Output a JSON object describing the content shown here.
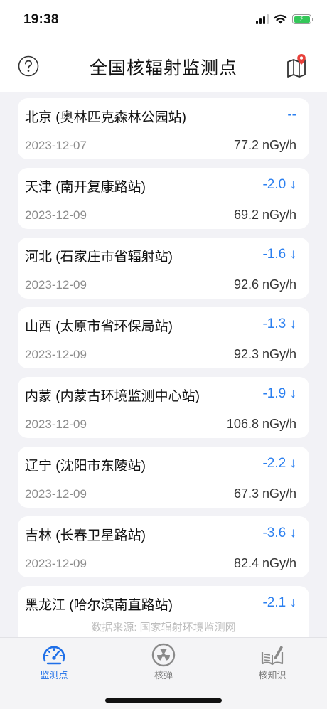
{
  "status_bar": {
    "time": "19:38"
  },
  "nav": {
    "title": "全国核辐射监测点",
    "help_icon": "question-circle-icon",
    "map_icon": "map-pin-icon"
  },
  "stations": [
    {
      "name": "北京 (奥林匹克森林公园站)",
      "change": "--",
      "date": "2023-12-07",
      "value": "77.2 nGy/h"
    },
    {
      "name": "天津 (南开复康路站)",
      "change": "-2.0 ↓",
      "date": "2023-12-09",
      "value": "69.2 nGy/h"
    },
    {
      "name": "河北 (石家庄市省辐射站)",
      "change": "-1.6 ↓",
      "date": "2023-12-09",
      "value": "92.6 nGy/h"
    },
    {
      "name": "山西 (太原市省环保局站)",
      "change": "-1.3 ↓",
      "date": "2023-12-09",
      "value": "92.3 nGy/h"
    },
    {
      "name": "内蒙 (内蒙古环境监测中心站)",
      "change": "-1.9 ↓",
      "date": "2023-12-09",
      "value": "106.8 nGy/h"
    },
    {
      "name": "辽宁 (沈阳市东陵站)",
      "change": "-2.2 ↓",
      "date": "2023-12-09",
      "value": "67.3 nGy/h"
    },
    {
      "name": "吉林 (长春卫星路站)",
      "change": "-3.6 ↓",
      "date": "2023-12-09",
      "value": "82.4 nGy/h"
    },
    {
      "name": "黑龙江 (哈尔滨南直路站)",
      "change": "-2.1 ↓",
      "date": "",
      "value": ""
    }
  ],
  "footer": {
    "source": "数据来源: 国家辐射环境监测网"
  },
  "tabs": [
    {
      "label": "监测点",
      "icon": "gauge-icon",
      "active": true
    },
    {
      "label": "核弹",
      "icon": "radiation-icon",
      "active": false
    },
    {
      "label": "核知识",
      "icon": "book-pen-icon",
      "active": false
    }
  ],
  "colors": {
    "accent": "#1e6fe8",
    "change": "#2a7ff0",
    "background": "#f2f2f6",
    "battery": "#34c759"
  }
}
